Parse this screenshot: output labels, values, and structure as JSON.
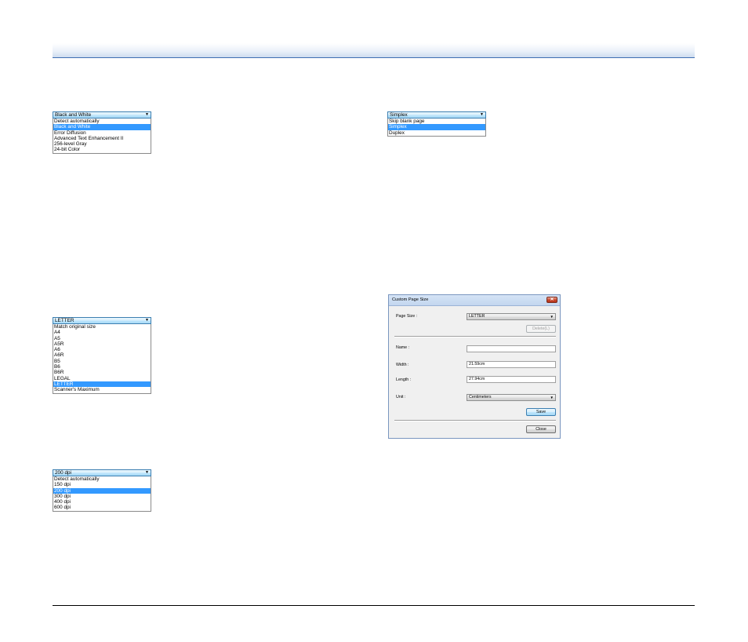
{
  "color_dropdown": {
    "selected": "Black and White",
    "options": [
      "Detect automatically",
      "Black and White",
      "Error Diffusion",
      "Advanced Text Enhancement II",
      "256-level Gray",
      "24-bit Color"
    ],
    "highlighted_index": 1
  },
  "side_dropdown": {
    "selected": "Simplex",
    "options": [
      "Skip blank page",
      "Simplex",
      "Duplex"
    ],
    "highlighted_index": 1
  },
  "page_size_dropdown": {
    "selected": "LETTER",
    "options": [
      "Match original size",
      "A4",
      "A5",
      "A5R",
      "A6",
      "A6R",
      "B5",
      "B6",
      "B6R",
      "LEGAL",
      "LETTER",
      "Scanner's Maximum"
    ],
    "highlighted_index": 10
  },
  "resolution_dropdown": {
    "selected": "200 dpi",
    "options": [
      "Detect automatically",
      "150 dpi",
      "200 dpi",
      "300 dpi",
      "400 dpi",
      "600 dpi"
    ],
    "highlighted_index": 2
  },
  "dialog": {
    "title": "Custom Page Size",
    "close_glyph": "✕",
    "page_size_label": "Page Size :",
    "page_size_value": "LETTER",
    "delete_label": "Delete(L)",
    "name_label": "Name :",
    "name_value": "",
    "width_label": "Width :",
    "width_value": "21.59cm",
    "length_label": "Length :",
    "length_value": "27.94cm",
    "unit_label": "Unit :",
    "unit_value": "Centimeters",
    "save_label": "Save",
    "close_label": "Close"
  },
  "colors": {
    "highlight": "#3399ff",
    "header_rule": "#3f6fb3"
  }
}
